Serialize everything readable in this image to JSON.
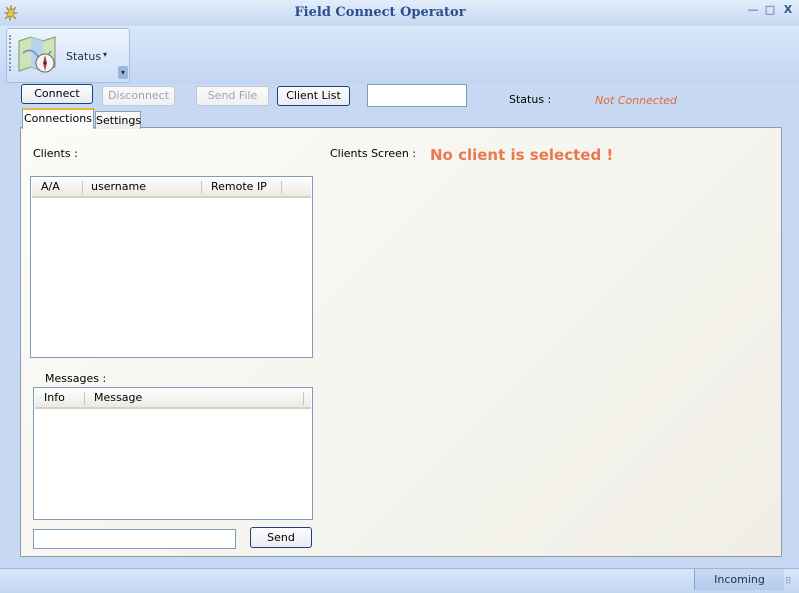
{
  "window": {
    "title": "Field Connect Operator",
    "controls": {
      "minimize": "—",
      "maximize": "□",
      "close": "X"
    }
  },
  "ribbon": {
    "status_button_label": "Status",
    "status_dropdown_glyph": "▾",
    "overflow_glyph": "▾"
  },
  "toolbar": {
    "connect_label": "Connect",
    "disconnect_label": "Disconnect",
    "send_file_label": "Send File",
    "client_list_label": "Client List",
    "text_field_value": "",
    "status_label": "Status :",
    "status_value": "Not Connected"
  },
  "tabs": [
    {
      "label": "Connections",
      "active": true
    },
    {
      "label": "Settings",
      "active": false
    }
  ],
  "connections": {
    "clients_label": "Clients :",
    "clients_columns": [
      "A/A",
      "username",
      "Remote IP"
    ],
    "clients_rows": [],
    "clients_screen_label": "Clients Screen :",
    "no_client_text": "No client is selected !",
    "messages_label": "Messages :",
    "messages_columns": [
      "Info",
      "Message"
    ],
    "messages_rows": [],
    "message_input_value": "",
    "send_label": "Send"
  },
  "statusbar": {
    "incoming_label": "Incoming",
    "grip_glyph": "⠿"
  },
  "colors": {
    "title_text": "#2b4f8c",
    "status_value": "#e06a3a",
    "no_client_text": "#e8794f",
    "active_tab_accent": "#f0b33c"
  }
}
